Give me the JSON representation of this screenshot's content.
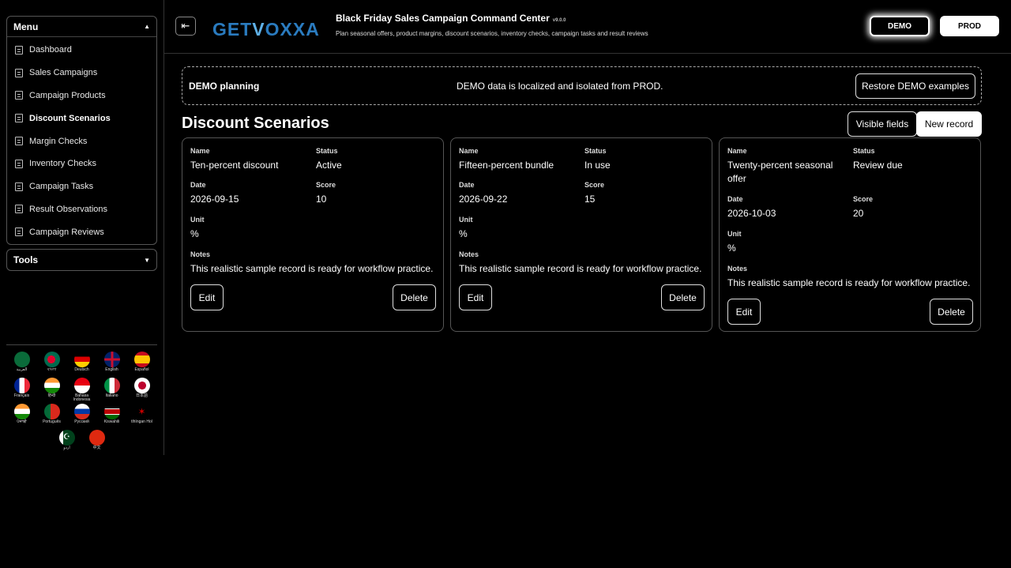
{
  "sidebar": {
    "menu_label": "Menu",
    "tools_label": "Tools",
    "items": [
      {
        "label": "Dashboard"
      },
      {
        "label": "Sales Campaigns"
      },
      {
        "label": "Campaign Products"
      },
      {
        "label": "Discount Scenarios"
      },
      {
        "label": "Margin Checks"
      },
      {
        "label": "Inventory Checks"
      },
      {
        "label": "Campaign Tasks"
      },
      {
        "label": "Result Observations"
      },
      {
        "label": "Campaign Reviews"
      }
    ],
    "languages": [
      {
        "label": "العربية",
        "flag": "saudi-flag"
      },
      {
        "label": "বাংলা",
        "flag": "bangladesh-flag"
      },
      {
        "label": "Deutsch",
        "flag": "germany-flag"
      },
      {
        "label": "English",
        "flag": "uk-flag"
      },
      {
        "label": "Español",
        "flag": "spain-flag"
      },
      {
        "label": "Français",
        "flag": "france-flag"
      },
      {
        "label": "हिन्दी",
        "flag": "india-flag"
      },
      {
        "label": "Bahasa Indonesia",
        "flag": "indonesia-flag"
      },
      {
        "label": "Italiano",
        "flag": "italy-flag"
      },
      {
        "label": "日本語",
        "flag": "japan-flag"
      },
      {
        "label": "ਪੰਜਾਬੀ",
        "flag": "india-flag"
      },
      {
        "label": "Português",
        "flag": "portugal-flag"
      },
      {
        "label": "Русский",
        "flag": "russia-flag"
      },
      {
        "label": "Kiswahili",
        "flag": "kenya-flag"
      },
      {
        "label": "tlhIngan Hol",
        "flag": "klingon-flag"
      },
      {
        "label": "اردو",
        "flag": "pakistan-flag"
      },
      {
        "label": "中文",
        "flag": "china-flag"
      }
    ]
  },
  "header": {
    "logo_text_a": "GET",
    "logo_text_v": "V",
    "logo_text_b": "OXXA",
    "title": "Black Friday Sales Campaign Command Center",
    "version": "v9.0.0",
    "subtitle": "Plan seasonal offers, product margins, discount scenarios, inventory checks, campaign tasks and result reviews",
    "demo_label": "DEMO",
    "prod_label": "PROD"
  },
  "banner": {
    "title": "DEMO planning",
    "message": "DEMO data is localized and isolated from PROD.",
    "restore_label": "Restore DEMO examples"
  },
  "main": {
    "title": "Discount Scenarios",
    "visible_fields_label": "Visible fields",
    "new_record_label": "New record",
    "field_labels": {
      "name": "Name",
      "status": "Status",
      "date": "Date",
      "score": "Score",
      "unit": "Unit",
      "notes": "Notes"
    },
    "edit_label": "Edit",
    "delete_label": "Delete",
    "records": [
      {
        "name": "Ten-percent discount",
        "status": "Active",
        "date": "2026-09-15",
        "score": "10",
        "unit": "%",
        "notes": "This realistic sample record is ready for workflow practice."
      },
      {
        "name": "Fifteen-percent bundle",
        "status": "In use",
        "date": "2026-09-22",
        "score": "15",
        "unit": "%",
        "notes": "This realistic sample record is ready for workflow practice."
      },
      {
        "name": "Twenty-percent seasonal offer",
        "status": "Review due",
        "date": "2026-10-03",
        "score": "20",
        "unit": "%",
        "notes": "This realistic sample record is ready for workflow practice."
      }
    ]
  },
  "colors": {
    "accent": "#2a7bbf",
    "background": "#000000"
  }
}
